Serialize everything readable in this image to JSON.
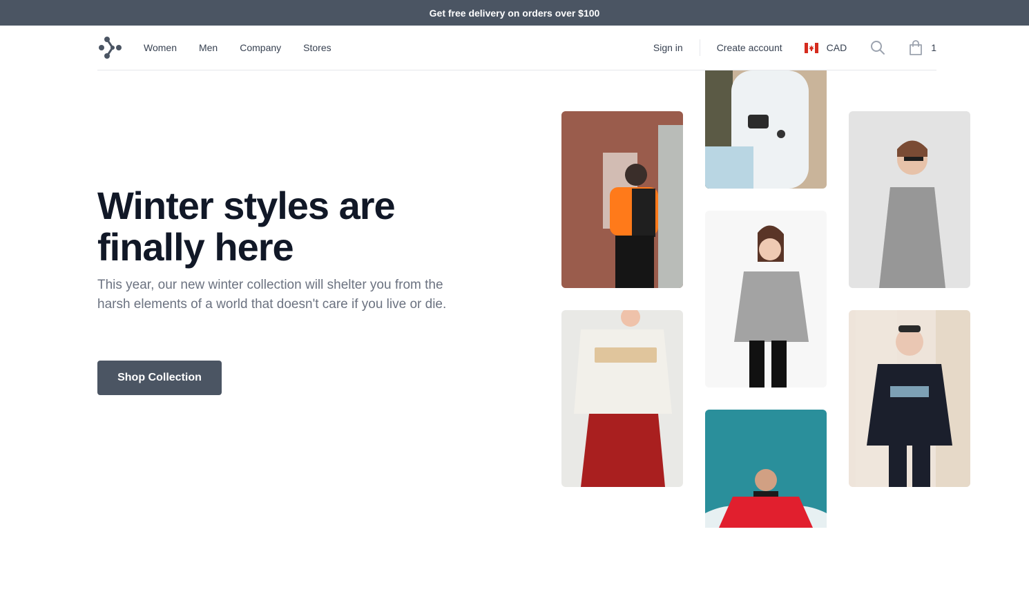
{
  "promo": {
    "text": "Get free delivery on orders over $100"
  },
  "nav": {
    "logo_icon": "brand-logo-icon",
    "links": [
      "Women",
      "Men",
      "Company",
      "Stores"
    ],
    "sign_in": "Sign in",
    "create_account": "Create account",
    "currency": "CAD",
    "currency_flag_icon": "canada-flag-icon",
    "search_icon": "search-icon",
    "cart_icon": "shopping-bag-icon",
    "cart_count": "1"
  },
  "hero": {
    "title": "Winter styles are finally here",
    "subtitle": "This year, our new winter collection will shelter you from the harsh elements of a world that doesn't care if you live or die.",
    "cta_label": "Shop Collection"
  },
  "gallery": {
    "images": [
      "man-orange-puffer-jacket-photo",
      "man-white-sweater-phone-photo",
      "woman-plaid-dress-sunglasses-photo",
      "woman-grey-sweatshirt-photo",
      "woman-au-revoir-sweater-photo",
      "man-boston-hoodie-photo",
      "man-red-hoodie-sky-photo"
    ]
  },
  "colors": {
    "promo_bg": "#4b5563",
    "heading": "#111827",
    "body_text": "#6b7280",
    "button_bg": "#4b5563",
    "border": "#e5e7eb"
  }
}
